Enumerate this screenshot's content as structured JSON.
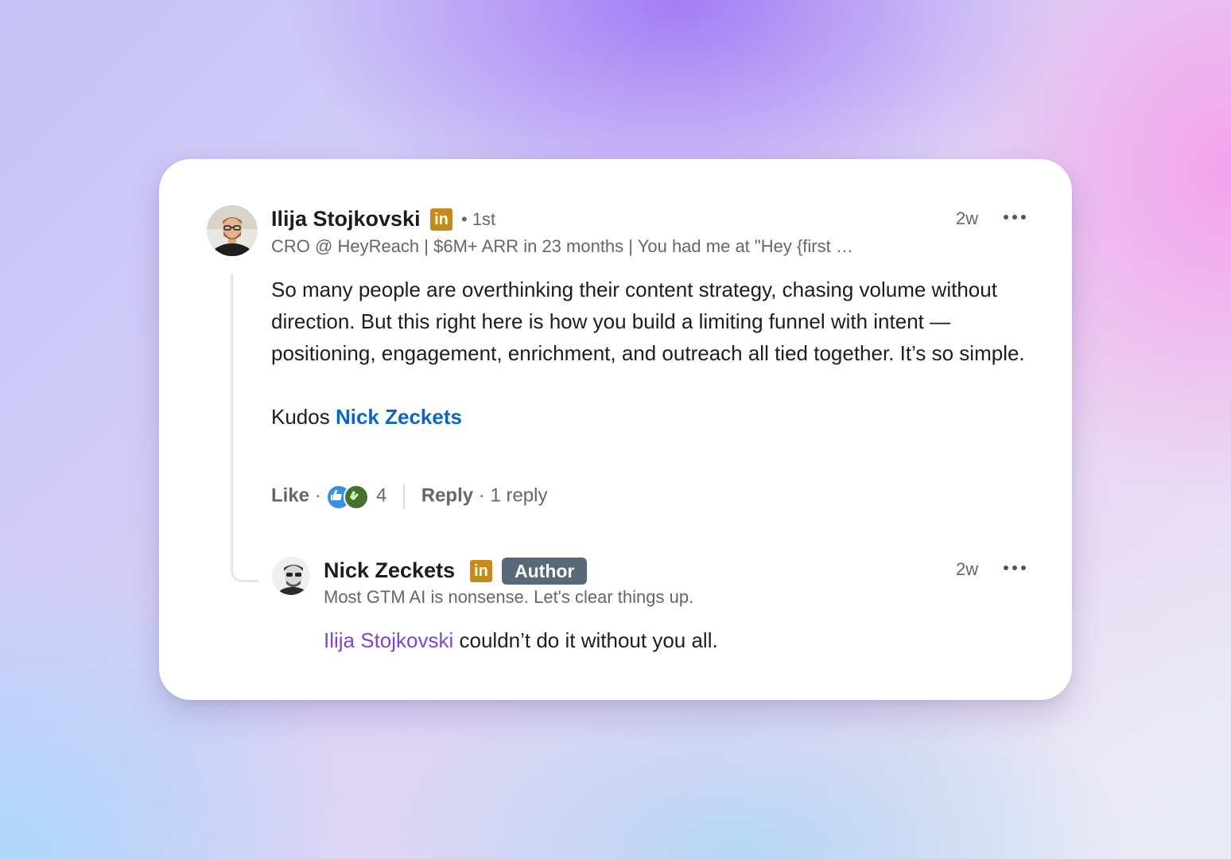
{
  "comment": {
    "author_name": "Ilija Stojkovski",
    "linkedin_badge": "in",
    "connection_degree": "• 1st",
    "headline": "CRO @ HeyReach | $6M+ ARR in 23 months | You had me at \"Hey {first …",
    "time": "2w",
    "body_paragraph": "So many people are overthinking their content strategy, chasing volume without direction. But this right here is how you build a limiting funnel with intent — positioning, engagement, enrichment, and outreach all tied together. It’s so simple.",
    "kudos_text": "Kudos",
    "kudos_mention": "Nick Zeckets",
    "actions": {
      "like": "Like",
      "separator_dot": "·",
      "reaction_count": "4",
      "reply": "Reply",
      "reply_count": "· 1 reply"
    }
  },
  "reply": {
    "author_name": "Nick Zeckets",
    "linkedin_badge": "in",
    "author_badge": "Author",
    "headline": "Most GTM AI is nonsense. Let's clear things up.",
    "time": "2w",
    "mention": "Ilija Stojkovski",
    "body_rest": " couldn’t do it without you all."
  },
  "colors": {
    "linkedin_badge": "#c68a1a",
    "mention_blue": "#0a66c2",
    "mention_purple": "#8344cc",
    "author_badge_bg": "#56687a",
    "reaction_like": "#378fe9",
    "reaction_celebrate": "#44712e"
  },
  "icons": {
    "reaction_1": "like-reaction-icon",
    "reaction_2": "celebrate-reaction-icon",
    "more": "more-options-icon"
  }
}
